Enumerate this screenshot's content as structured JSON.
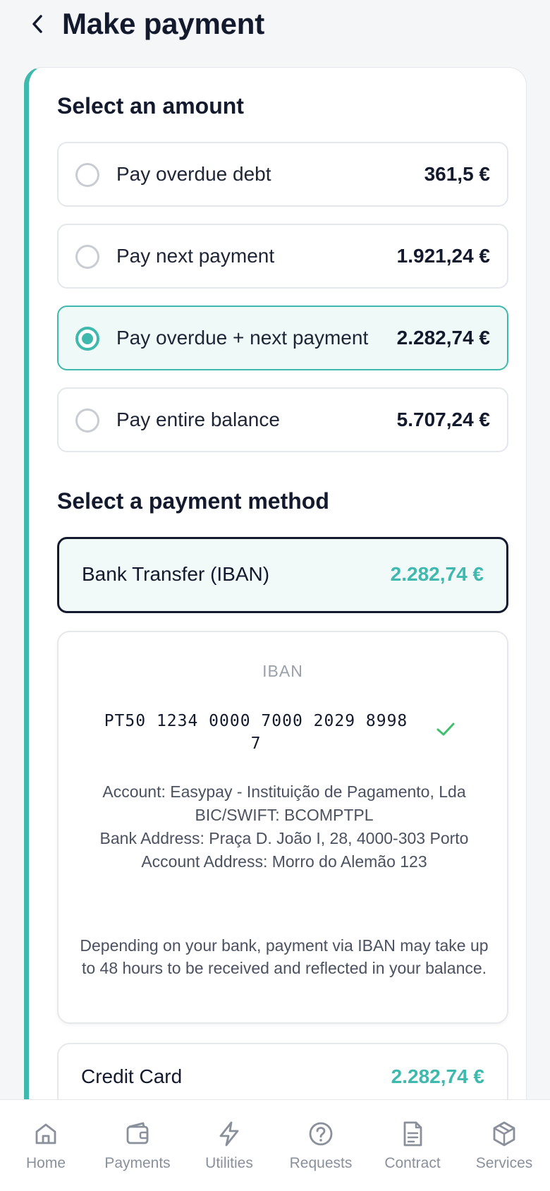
{
  "header": {
    "title": "Make payment",
    "back_icon": "chevron-left-icon"
  },
  "amount_section": {
    "title": "Select an amount",
    "options": [
      {
        "label": "Pay overdue debt",
        "amount": "361,5 €",
        "selected": false
      },
      {
        "label": "Pay next payment",
        "amount": "1.921,24 €",
        "selected": false
      },
      {
        "label": "Pay overdue + next payment",
        "amount": "2.282,74 €",
        "selected": true
      },
      {
        "label": "Pay entire balance",
        "amount": "5.707,24 €",
        "selected": false
      }
    ]
  },
  "method_section": {
    "title": "Select a payment method",
    "bank_transfer": {
      "label": "Bank Transfer (IBAN)",
      "amount": "2.282,74 €"
    },
    "iban_panel": {
      "caption": "IBAN",
      "iban": "PT50 1234 0000 7000 2029 8998 7",
      "copied_icon": "check-icon",
      "account": "Account: Easypay - Instituição de Pagamento, Lda",
      "bic": "BIC/SWIFT: BCOMPTPL",
      "bank_address": "Bank Address: Praça D. João I, 28, 4000-303 Porto",
      "account_address": "Account Address: Morro do Alemão 123",
      "note": "Depending on your bank, payment via IBAN may take up to 48 hours to be received and reflected in your balance."
    },
    "credit_card": {
      "label": "Credit Card",
      "amount": "2.282,74 €"
    }
  },
  "bottom_nav": {
    "items": [
      {
        "label": "Home",
        "icon": "home-icon"
      },
      {
        "label": "Payments",
        "icon": "wallet-icon"
      },
      {
        "label": "Utilities",
        "icon": "lightning-icon"
      },
      {
        "label": "Requests",
        "icon": "help-circle-icon"
      },
      {
        "label": "Contract",
        "icon": "document-icon"
      },
      {
        "label": "Services",
        "icon": "package-icon"
      }
    ]
  },
  "colors": {
    "accent": "#3fb9ae",
    "text": "#141a2e",
    "muted": "#8a909b",
    "background": "#f5f6f8"
  }
}
